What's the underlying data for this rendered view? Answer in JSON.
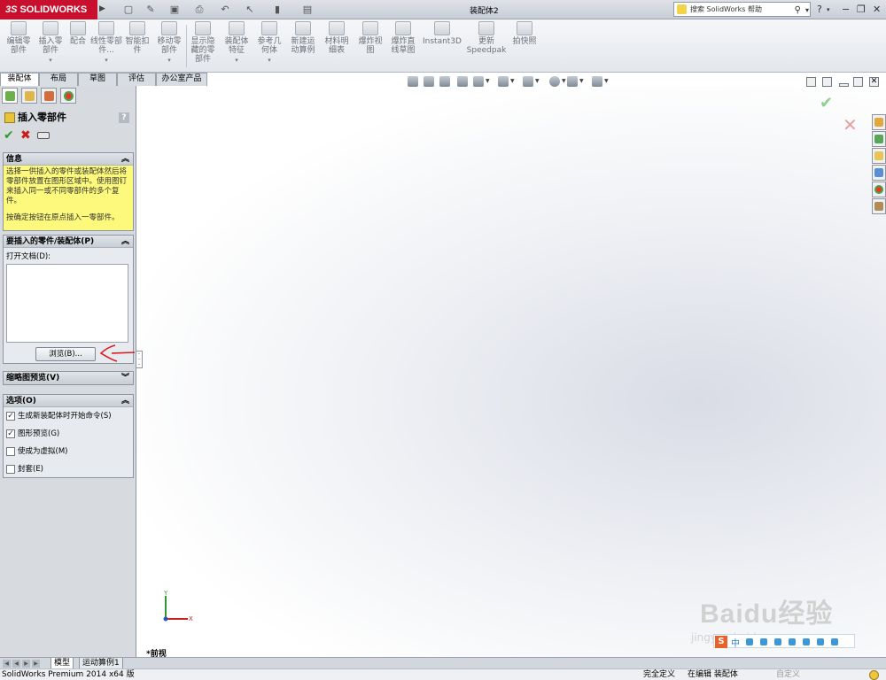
{
  "titlebar": {
    "app_name": "SOLIDWORKS",
    "document_title": "装配体2",
    "search_placeholder": "搜索 SolidWorks 帮助",
    "help_label": "?",
    "quick_access_icons": [
      "new-icon",
      "open-icon",
      "save-icon",
      "print-icon",
      "undo-icon",
      "select-icon",
      "rebuild-icon",
      "options-icon"
    ]
  },
  "ribbon": {
    "buttons": [
      {
        "label": "编辑零部件"
      },
      {
        "label": "插入零部件"
      },
      {
        "label": "配合"
      },
      {
        "label": "线性零部件..."
      },
      {
        "label": "智能扣件"
      },
      {
        "label": "移动零部件"
      },
      {
        "label": "显示隐藏的零部件"
      },
      {
        "label": "装配体特征"
      },
      {
        "label": "参考几何体"
      },
      {
        "label": "新建运动算例"
      },
      {
        "label": "材料明细表"
      },
      {
        "label": "爆炸视图"
      },
      {
        "label": "爆炸直线草图"
      },
      {
        "label": "Instant3D"
      },
      {
        "label": "更新Speedpak"
      },
      {
        "label": "拍快照"
      }
    ]
  },
  "command_tabs": [
    {
      "label": "装配体",
      "active": true
    },
    {
      "label": "布局",
      "active": false
    },
    {
      "label": "草图",
      "active": false
    },
    {
      "label": "评估",
      "active": false
    },
    {
      "label": "办公室产品",
      "active": false
    }
  ],
  "property_manager": {
    "title": "插入零部件",
    "help": "?",
    "message": {
      "heading": "信息",
      "line1": "选择一供插入的零件或装配体然后将零部件放置在图形区域中。使用图钉来插入同一或不同零部件的多个复件。",
      "line2": "按确定按钮在原点插入一零部件。"
    },
    "part_group": {
      "heading": "要插入的零件/装配体(P)",
      "open_docs_label": "打开文档(D):",
      "browse_label": "浏览(B)..."
    },
    "thumbnail_group": {
      "heading": "缩略图预览(V)"
    },
    "options_group": {
      "heading": "选项(O)",
      "options": [
        {
          "label": "生成新装配体时开始命令(S)",
          "checked": true
        },
        {
          "label": "图形预览(G)",
          "checked": true
        },
        {
          "label": "使成为虚拟(M)",
          "checked": false
        },
        {
          "label": "封套(E)",
          "checked": false
        }
      ]
    }
  },
  "graphics": {
    "view_label": "*前视",
    "axis_x": "X",
    "axis_y": "Y"
  },
  "bottom_tabs": [
    {
      "label": "模型",
      "active": true
    },
    {
      "label": "运动算例1",
      "active": false
    }
  ],
  "statusbar": {
    "product": "SolidWorks Premium 2014 x64 版",
    "status1": "完全定义",
    "status2": "在编辑 装配体",
    "status3": "自定义"
  },
  "watermark": {
    "brand": "Baidu经验",
    "url": "jingyan.baidu.com",
    "ime_label": "中"
  },
  "colors": {
    "brand_red": "#c8102e",
    "message_yellow": "#fcf97c",
    "ok_green": "#2c9a2c",
    "cancel_red": "#cc1b1b"
  }
}
